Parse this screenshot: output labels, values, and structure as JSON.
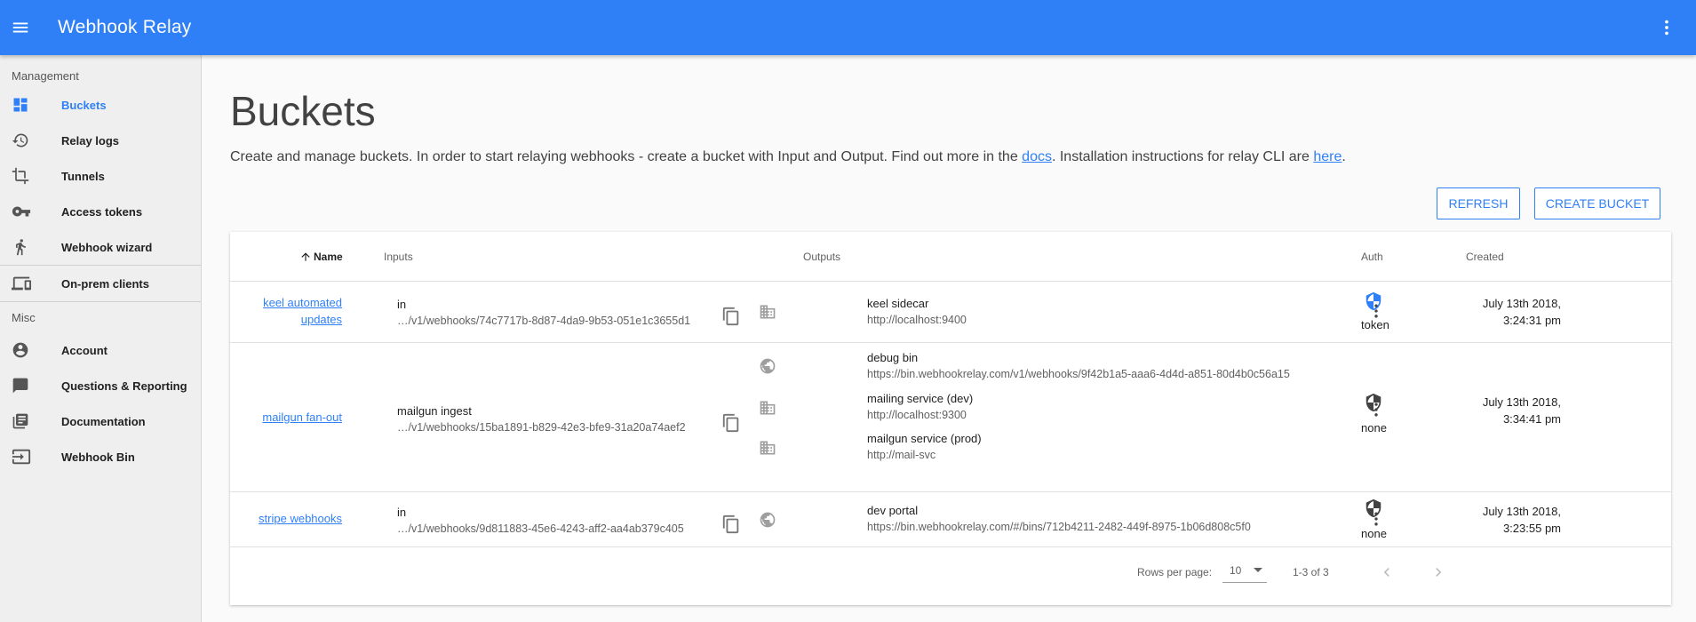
{
  "app": {
    "title": "Webhook Relay"
  },
  "sidebar": {
    "section_management": "Management",
    "section_misc": "Misc",
    "items": [
      {
        "label": "Buckets",
        "icon": "dashboard-icon"
      },
      {
        "label": "Relay logs",
        "icon": "history-icon"
      },
      {
        "label": "Tunnels",
        "icon": "crop-icon"
      },
      {
        "label": "Access tokens",
        "icon": "key-icon"
      },
      {
        "label": "Webhook wizard",
        "icon": "walk-icon"
      },
      {
        "label": "On-prem clients",
        "icon": "devices-icon"
      },
      {
        "label": "Account",
        "icon": "account-icon"
      },
      {
        "label": "Questions & Reporting",
        "icon": "chat-icon"
      },
      {
        "label": "Documentation",
        "icon": "library-icon"
      },
      {
        "label": "Webhook Bin",
        "icon": "input-icon"
      }
    ],
    "active_color": "#2f80f7"
  },
  "page": {
    "title": "Buckets",
    "desc_1": "Create and manage buckets. In order to start relaying webhooks - create a bucket with Input and Output. Find out more in the ",
    "desc_link_docs": "docs",
    "desc_2": ". Installation instructions for relay CLI are ",
    "desc_link_here": "here",
    "desc_3": "."
  },
  "actions": {
    "refresh": "REFRESH",
    "create": "CREATE BUCKET"
  },
  "table": {
    "headers": {
      "name": "Name",
      "inputs": "Inputs",
      "outputs": "Outputs",
      "auth": "Auth",
      "created": "Created"
    },
    "rows": [
      {
        "name_line1": "keel automated",
        "name_line2": "updates",
        "input_label": "in",
        "input_url": "…/v1/webhooks/74c7717b-8d87-4da9-9b53-051e1c3655d1",
        "outputs": [
          {
            "name": "keel sidecar",
            "url": "http://localhost:9400",
            "icon": "building-icon"
          }
        ],
        "auth": "token",
        "created_line1": "July 13th 2018,",
        "created_line2": "3:24:31 pm"
      },
      {
        "name_line1": "mailgun fan-out",
        "input_label": "mailgun ingest",
        "input_url": "…/v1/webhooks/15ba1891-b829-42e3-bfe9-31a20a74aef2",
        "outputs": [
          {
            "name": "debug bin",
            "url": "https://bin.webhookrelay.com/v1/webhooks/9f42b1a5-aaa6-4d4d-a851-80d4b0c56a15",
            "icon": "globe-icon"
          },
          {
            "name": "mailing service (dev)",
            "url": "http://localhost:9300",
            "icon": "building-icon"
          },
          {
            "name": "mailgun service (prod)",
            "url": "http://mail-svc",
            "icon": "building-icon"
          }
        ],
        "auth": "none",
        "created_line1": "July 13th 2018,",
        "created_line2": "3:34:41 pm"
      },
      {
        "name_line1": "stripe webhooks",
        "input_label": "in",
        "input_url": "…/v1/webhooks/9d811883-45e6-4243-aff2-aa4ab379c405",
        "outputs": [
          {
            "name": "dev portal",
            "url": "https://bin.webhookrelay.com/#/bins/712b4211-2482-449f-8975-1b06d808c5f0",
            "icon": "globe-icon"
          }
        ],
        "auth": "none",
        "created_line1": "July 13th 2018,",
        "created_line2": "3:23:55 pm"
      }
    ]
  },
  "pagination": {
    "rows_per_page_label": "Rows per page:",
    "rows_per_page": "10",
    "range": "1-3 of 3"
  },
  "colors": {
    "primary": "#2f80f7",
    "shield_token": "#2f80f7",
    "shield_none": "#424242"
  }
}
